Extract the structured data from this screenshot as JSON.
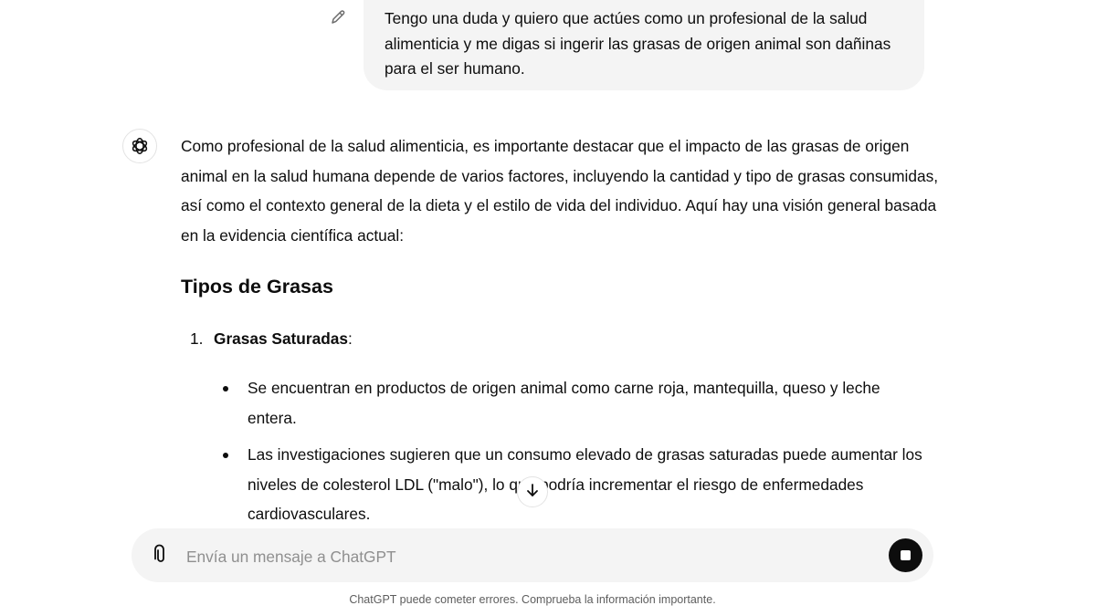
{
  "conversation": {
    "user_message": "Tengo una duda y quiero que actúes como un profesional de la salud alimenticia y me digas si ingerir las grasas de origen animal son dañinas para el ser humano.",
    "assistant": {
      "intro": "Como profesional de la salud alimenticia, es importante destacar que el impacto de las grasas de origen animal en la salud humana depende de varios factores, incluyendo la cantidad y tipo de grasas consumidas, así como el contexto general de la dieta y el estilo de vida del individuo. Aquí hay una visión general basada en la evidencia científica actual:",
      "heading": "Tipos de Grasas",
      "list_item_number": "1.",
      "list_item_title": "Grasas Saturadas",
      "list_item_colon": ":",
      "bullets": [
        "Se encuentran en productos de origen animal como carne roja, mantequilla, queso y leche entera.",
        "Las investigaciones sugieren que un consumo elevado de grasas saturadas puede aumentar los niveles de colesterol LDL (\"malo\"), lo que podría incrementar el riesgo de enfermedades cardiovasculares."
      ]
    }
  },
  "composer": {
    "placeholder": "Envía un mensaje a ChatGPT"
  },
  "footer": {
    "disclaimer": "ChatGPT puede cometer errores. Comprueba la información importante."
  },
  "icons": {
    "edit": "pencil-icon",
    "avatar": "chatgpt-logo-icon",
    "scroll": "arrow-down-icon",
    "attach": "paperclip-icon",
    "stop": "stop-icon"
  }
}
